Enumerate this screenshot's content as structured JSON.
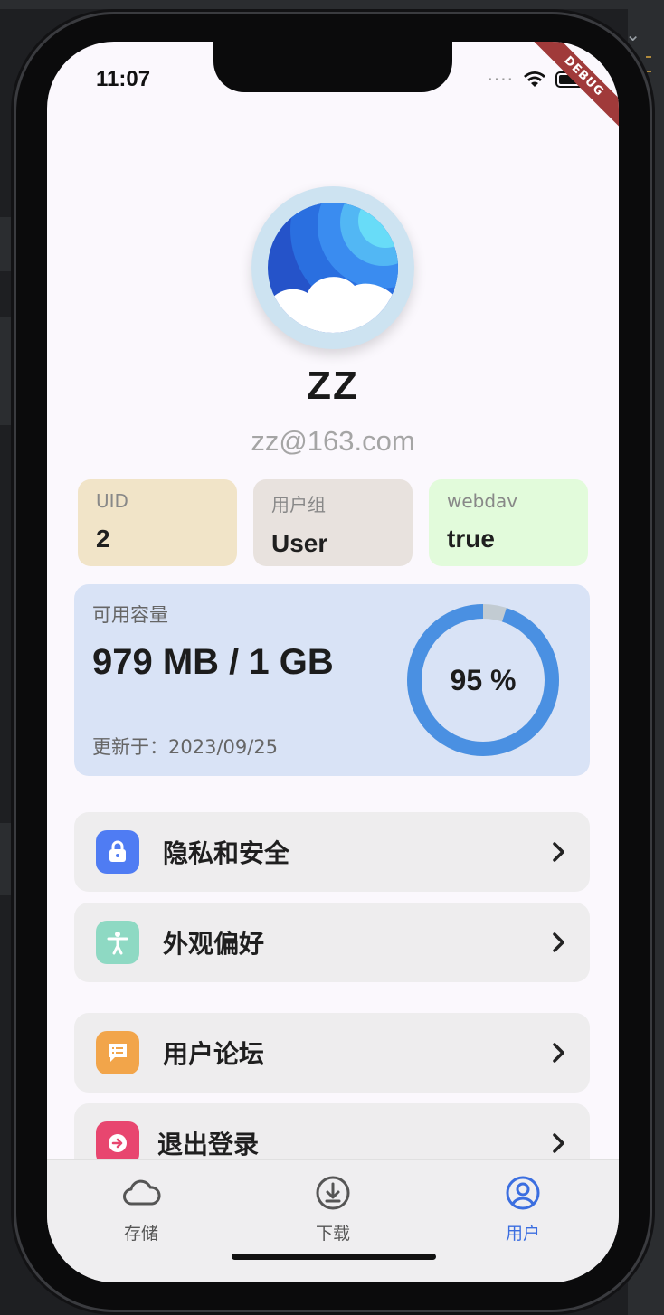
{
  "status_bar": {
    "time": "11:07",
    "debug_label": "DEBUG"
  },
  "profile": {
    "name": "ZZ",
    "email": "zz@163.com"
  },
  "info_cards": [
    {
      "label": "UID",
      "value": "2",
      "color": "#f1e4c8"
    },
    {
      "label": "用户组",
      "value": "User",
      "color": "#e8e2de"
    },
    {
      "label": "webdav",
      "value": "true",
      "color": "#e2fbdb"
    }
  ],
  "storage": {
    "label": "可用容量",
    "value": "979 MB / 1 GB",
    "updated": "更新于：2023/09/25",
    "percent_text": "95 %",
    "percent": 95,
    "ring_color": "#4a90e2",
    "ring_track_color": "#c2cbd2"
  },
  "menu": [
    {
      "label": "隐私和安全",
      "icon": "lock-icon",
      "color": "#4f7cf3"
    },
    {
      "label": "外观偏好",
      "icon": "accessibility-icon",
      "color": "#8ed9c3"
    },
    {
      "label": "用户论坛",
      "icon": "forum-icon",
      "color": "#f2a54a"
    },
    {
      "label": "退出登录",
      "icon": "logout-icon",
      "color": "#e8466f"
    }
  ],
  "tabs": [
    {
      "label": "存储",
      "icon": "cloud-icon",
      "active": false
    },
    {
      "label": "下载",
      "icon": "download-icon",
      "active": false
    },
    {
      "label": "用户",
      "icon": "user-circle-icon",
      "active": true
    }
  ],
  "colors": {
    "accent": "#3b6ee0",
    "background": "#fbf8fd"
  }
}
